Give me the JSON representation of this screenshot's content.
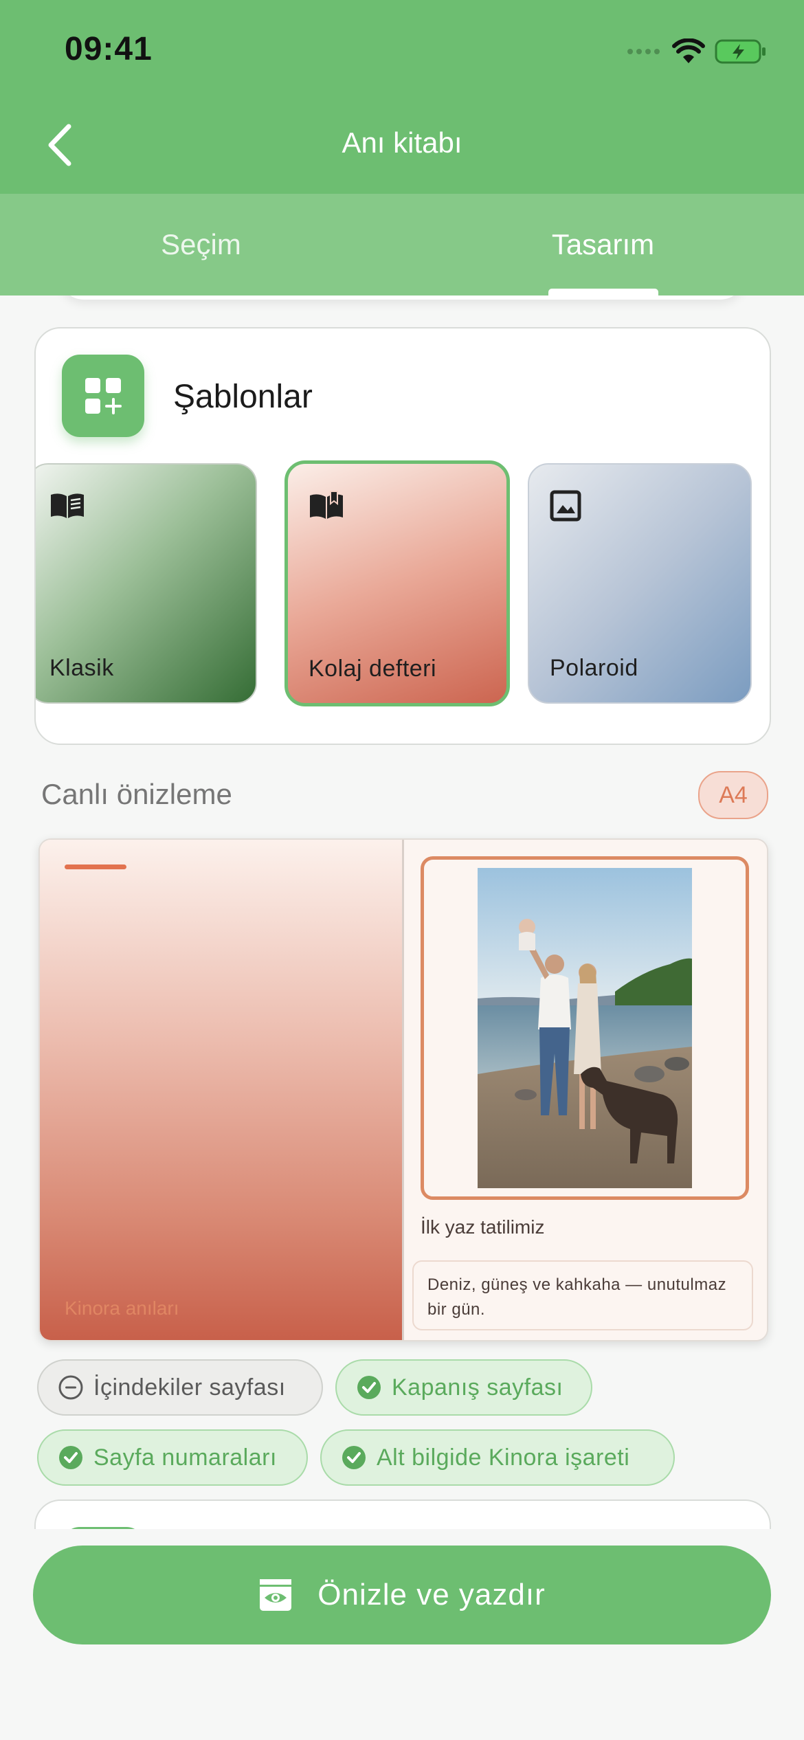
{
  "status_bar": {
    "time": "09:41"
  },
  "header": {
    "title": "Anı kitabı"
  },
  "tabs": [
    {
      "label": "Seçim",
      "active": false
    },
    {
      "label": "Tasarım",
      "active": true
    }
  ],
  "templates_card": {
    "title": "Şablonlar",
    "icon": "grid-add-icon",
    "items": [
      {
        "label": "Klasik",
        "icon": "open-book-icon",
        "selected": false
      },
      {
        "label": "Kolaj defteri",
        "icon": "reading-book-icon",
        "selected": true
      },
      {
        "label": "Polaroid",
        "icon": "image-icon",
        "selected": false
      }
    ]
  },
  "preview": {
    "label": "Canlı önizleme",
    "size": "A4",
    "cover_text": "Kinora anıları",
    "photo_caption": "İlk yaz tatilimiz",
    "note": "Deniz, güneş ve kahkaha — unutulmaz bir gün."
  },
  "options": [
    {
      "label": "İçindekiler sayfası",
      "enabled": false
    },
    {
      "label": "Kapanış sayfası",
      "enabled": true
    },
    {
      "label": "Sayfa numaraları",
      "enabled": true
    },
    {
      "label": "Alt bilgide Kinora işareti",
      "enabled": true
    }
  ],
  "cta": {
    "label": "Önizle ve yazdır",
    "icon": "preview-eye-icon"
  },
  "colors": {
    "primary": "#6dbe71",
    "tab_bar": "#86c988",
    "accent": "#dc8a63"
  }
}
